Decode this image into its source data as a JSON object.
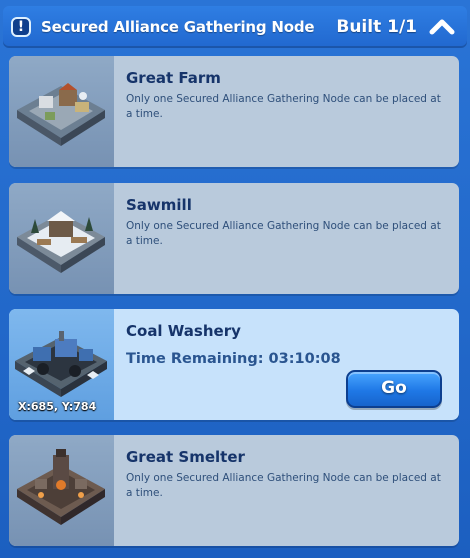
{
  "header": {
    "title": "Secured Alliance Gathering Node",
    "built_label": "Built 1/1",
    "alert_glyph": "!",
    "alert_icon": "alert-icon",
    "collapse_icon": "chevron-up-icon"
  },
  "cards": [
    {
      "title": "Great Farm",
      "description": "Only one Secured Alliance Gathering Node can be placed at a time.",
      "image_icon": "farm-building-image",
      "state": "locked"
    },
    {
      "title": "Sawmill",
      "description": "Only one Secured Alliance Gathering Node can be placed at a time.",
      "image_icon": "sawmill-building-image",
      "state": "locked"
    },
    {
      "title": "Coal Washery",
      "timer": "Time Remaining: 03:10:08",
      "coords": "X:685, Y:784",
      "button_label": "Go",
      "image_icon": "coal-washery-building-image",
      "state": "active"
    },
    {
      "title": "Great Smelter",
      "description": "Only one Secured Alliance Gathering Node can be placed at a time.",
      "image_icon": "smelter-building-image",
      "state": "locked"
    }
  ],
  "colors": {
    "background": "#1f66c8",
    "card_active": "#c7e2fb",
    "card_disabled": "#b9cadc",
    "title_text": "#16346a",
    "button": "#1f78e6"
  }
}
